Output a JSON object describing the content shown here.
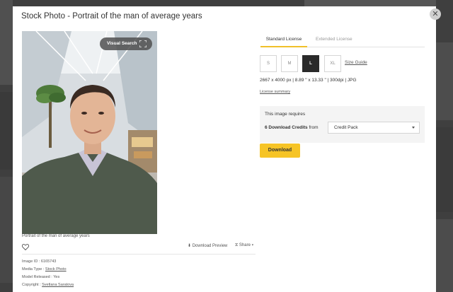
{
  "modal": {
    "title": "Stock Photo - Portrait of the man of average years",
    "close_icon": "close-icon"
  },
  "photo": {
    "visual_search_label": "Visual Search",
    "expand_icon": "expand-icon",
    "caption": "Portrait of the man of average years"
  },
  "actions": {
    "favorite_icon": "heart-icon",
    "download_preview_label": "Download Preview",
    "share_label": "Share"
  },
  "meta": {
    "image_id_label": "Image ID : ",
    "image_id": "6165743",
    "media_type_label": "Media Type : ",
    "media_type": "Stock Photo",
    "model_released_label": "Model Released : ",
    "model_released": "Yes",
    "copyright_label": "Copyright : ",
    "copyright": "Svetlana Saratova"
  },
  "license": {
    "tabs": [
      {
        "label": "Standard License",
        "active": true
      },
      {
        "label": "Extended License",
        "active": false
      }
    ],
    "sizes": [
      {
        "label": "S",
        "selected": false
      },
      {
        "label": "M",
        "selected": false
      },
      {
        "label": "L",
        "selected": true
      },
      {
        "label": "XL",
        "selected": false
      }
    ],
    "size_guide_label": "Size Guide",
    "spec": "2667 x 4000 px | 8.89 \" x 13.33 \" | 300dpi | JPG",
    "license_summary_label": "License summary",
    "requires_title": "This image requires",
    "credits_bold": "6 Download Credits",
    "credits_from": "from",
    "payment_option": "Credit Pack",
    "download_label": "Download"
  },
  "colors": {
    "accent": "#f6c426",
    "selected_size": "#2a2a2a",
    "tab_underline": "#f0c02a"
  }
}
